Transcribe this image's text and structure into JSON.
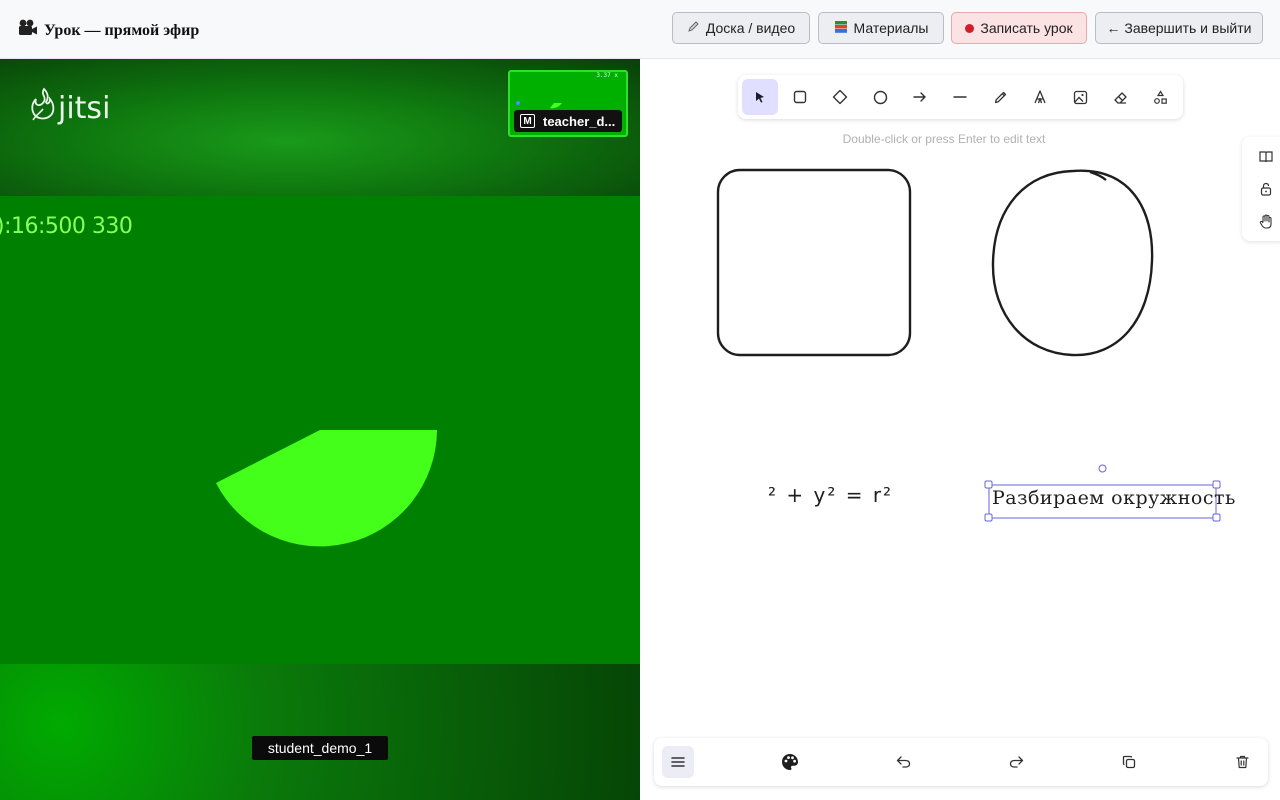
{
  "header": {
    "title": "Урок — прямой эфир",
    "title_icon": "film-camera-icon",
    "buttons": {
      "board": "Доска / видео",
      "materials": "Материалы",
      "record": "Записать урок",
      "finish": "← Завершить и выйти"
    }
  },
  "video": {
    "logo_text": "jitsi",
    "overlay_text": "):16:500 330",
    "thumb_badge": "M",
    "thumb_tiny": "3.37 x",
    "thumbnail_name": "teacher_d...",
    "participant_name": "student_demo_1",
    "colors": {
      "background": "#008000",
      "shape": "#44ff1a"
    }
  },
  "whiteboard": {
    "hint": "Double-click or press Enter to edit text",
    "formula": "² + y² = r²",
    "selected_text": "Разбираем окружность",
    "tools": [
      "selection-tool",
      "rectangle-tool",
      "diamond-tool",
      "ellipse-tool",
      "arrow-tool",
      "line-tool",
      "pencil-tool",
      "text-tool",
      "image-tool",
      "eraser-tool",
      "more-tools"
    ],
    "side_tools": [
      "library-icon",
      "lock-icon",
      "hand-icon"
    ],
    "bottom_actions": [
      "menu",
      "palette",
      "undo",
      "redo",
      "duplicate",
      "delete"
    ],
    "accent": "#6965db"
  }
}
